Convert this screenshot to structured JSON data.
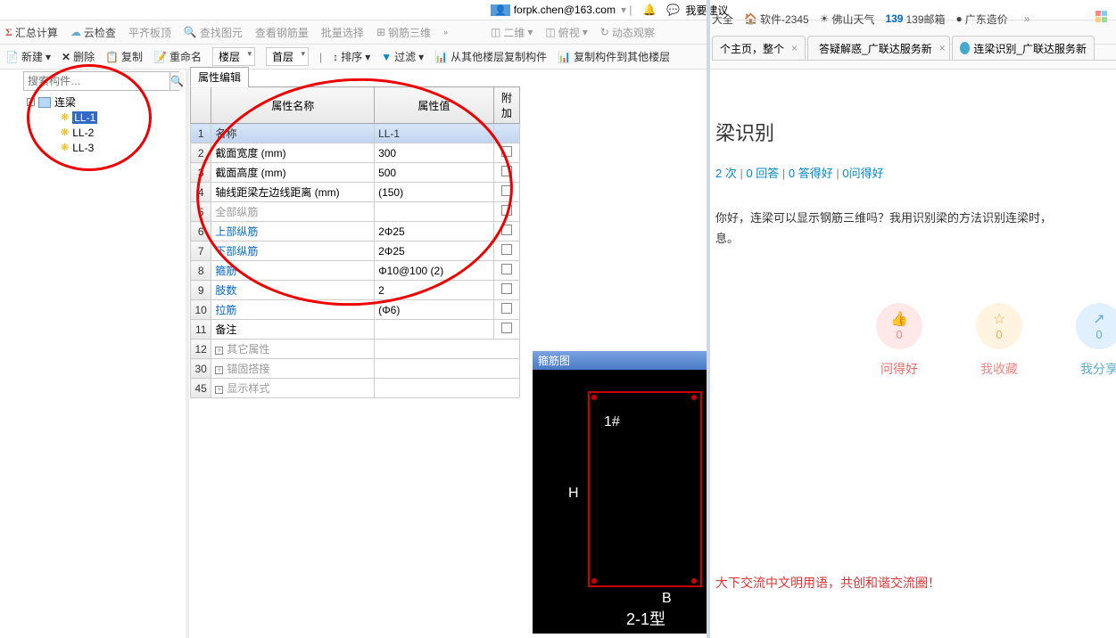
{
  "topbar": {
    "email": "forpk.chen@163.com",
    "suggest": "我要建议"
  },
  "bookmarks": {
    "b1": "大全",
    "b2": "软件-2345",
    "b3": "佛山天气",
    "b4": "139邮箱",
    "b5": "广东造价",
    "more": "»"
  },
  "browserTabs": {
    "t1": "个主页，整个",
    "t2": "答疑解惑_广联达服务新",
    "t3": "连梁识别_广联达服务新"
  },
  "toolbar1": {
    "t1": "汇总计算",
    "t2": "云检查",
    "t3": "平齐板顶",
    "t4": "查找图元",
    "t5": "查看钢筋量",
    "t6": "批量选择",
    "t7": "钢筋三维",
    "v1": "二维",
    "v2": "俯视",
    "v3": "动态观察"
  },
  "toolbar2": {
    "b1": "新建",
    "b2": "删除",
    "b3": "复制",
    "b4": "重命名",
    "dd1": "楼层",
    "dd2": "首层",
    "b5": "排序",
    "b6": "过滤",
    "b7": "从其他楼层复制构件",
    "b8": "复制构件到其他楼层"
  },
  "search": {
    "placeholder": "搜索构件…"
  },
  "tree": {
    "root": "连梁",
    "items": [
      "LL-1",
      "LL-2",
      "LL-3"
    ]
  },
  "propPanel": {
    "tab": "属性编辑",
    "h1": "属性名称",
    "h2": "属性值",
    "h3": "附加",
    "rows": [
      {
        "n": "1",
        "name": "名称",
        "val": "LL-1",
        "hdr": true
      },
      {
        "n": "2",
        "name": "截面宽度 (mm)",
        "val": "300"
      },
      {
        "n": "3",
        "name": "截面高度 (mm)",
        "val": "500"
      },
      {
        "n": "4",
        "name": "轴线距梁左边线距离 (mm)",
        "val": "(150)"
      },
      {
        "n": "5",
        "name": "全部纵筋",
        "val": "",
        "gray": true
      },
      {
        "n": "6",
        "name": "上部纵筋",
        "val": "2Φ25",
        "blue": true
      },
      {
        "n": "7",
        "name": "下部纵筋",
        "val": "2Φ25",
        "blue": true
      },
      {
        "n": "8",
        "name": "箍筋",
        "val": "Φ10@100 (2)",
        "blue": true
      },
      {
        "n": "9",
        "name": "肢数",
        "val": "2",
        "blue": true
      },
      {
        "n": "10",
        "name": "拉筋",
        "val": "(Φ6)",
        "blue": true
      },
      {
        "n": "11",
        "name": "备注",
        "val": ""
      },
      {
        "n": "12",
        "name": "其它属性",
        "exp": true,
        "gray": true
      },
      {
        "n": "30",
        "name": "锚固搭接",
        "exp": true,
        "gray": true
      },
      {
        "n": "45",
        "name": "显示样式",
        "exp": true,
        "gray": true
      }
    ]
  },
  "stirrup": {
    "title": "箍筋图",
    "l1": "1#",
    "lH": "H",
    "lB": "B",
    "type": "2-1型"
  },
  "web": {
    "title": "梁识别",
    "stats_a": "2 次",
    "stats_b": "0 回答",
    "stats_c": "0 答得好",
    "stats_d": "0问得好",
    "body1": "你好，连梁可以显示钢筋三维吗？我用识别梁的方法识别连梁时，",
    "body2": "息。",
    "actions": {
      "a1_count": "0",
      "a1_label": "问得好",
      "a2_count": "0",
      "a2_label": "我收藏",
      "a3_count": "0",
      "a3_label": "我分享"
    },
    "note": "大下交流中文明用语，共创和谐交流圈！"
  }
}
